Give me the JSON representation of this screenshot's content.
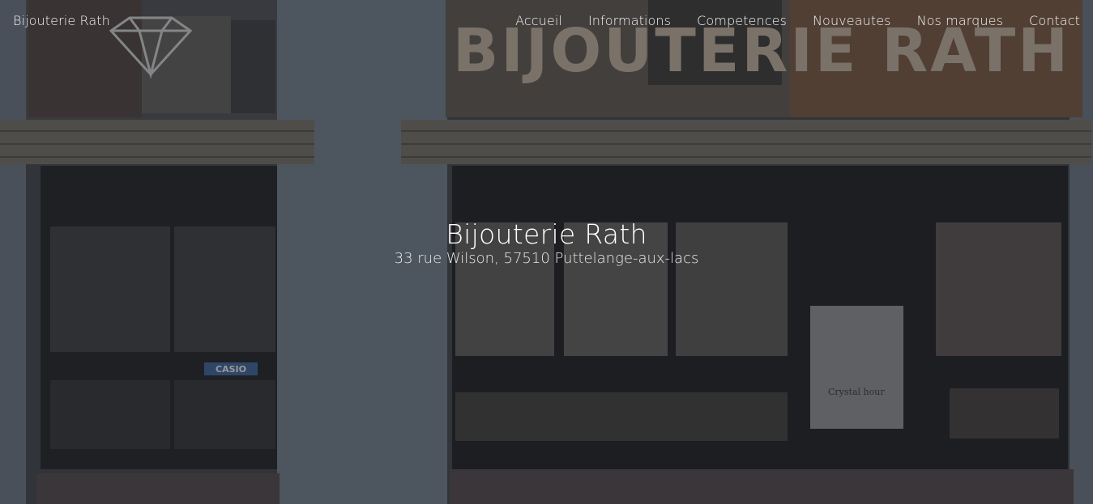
{
  "header": {
    "brand": "Bijouterie Rath",
    "nav": [
      {
        "label": "Accueil"
      },
      {
        "label": "Informations"
      },
      {
        "label": "Competences"
      },
      {
        "label": "Nouveautes"
      },
      {
        "label": "Nos marques"
      },
      {
        "label": "Contact"
      }
    ]
  },
  "hero": {
    "title": "Bijouterie Rath",
    "address": "33 rue Wilson, 57510 Puttelange-aux-lacs",
    "sign_text": "BIJOUTERIE RATH",
    "poster_text": "Crystal hour",
    "casio_label": "CASIO"
  },
  "colors": {
    "overlay": "#2b2d31",
    "facade": "#7f8fa0",
    "awning": "#9a958a",
    "sign": "#c7b8a6",
    "nav_text": "#f3f3f3"
  }
}
